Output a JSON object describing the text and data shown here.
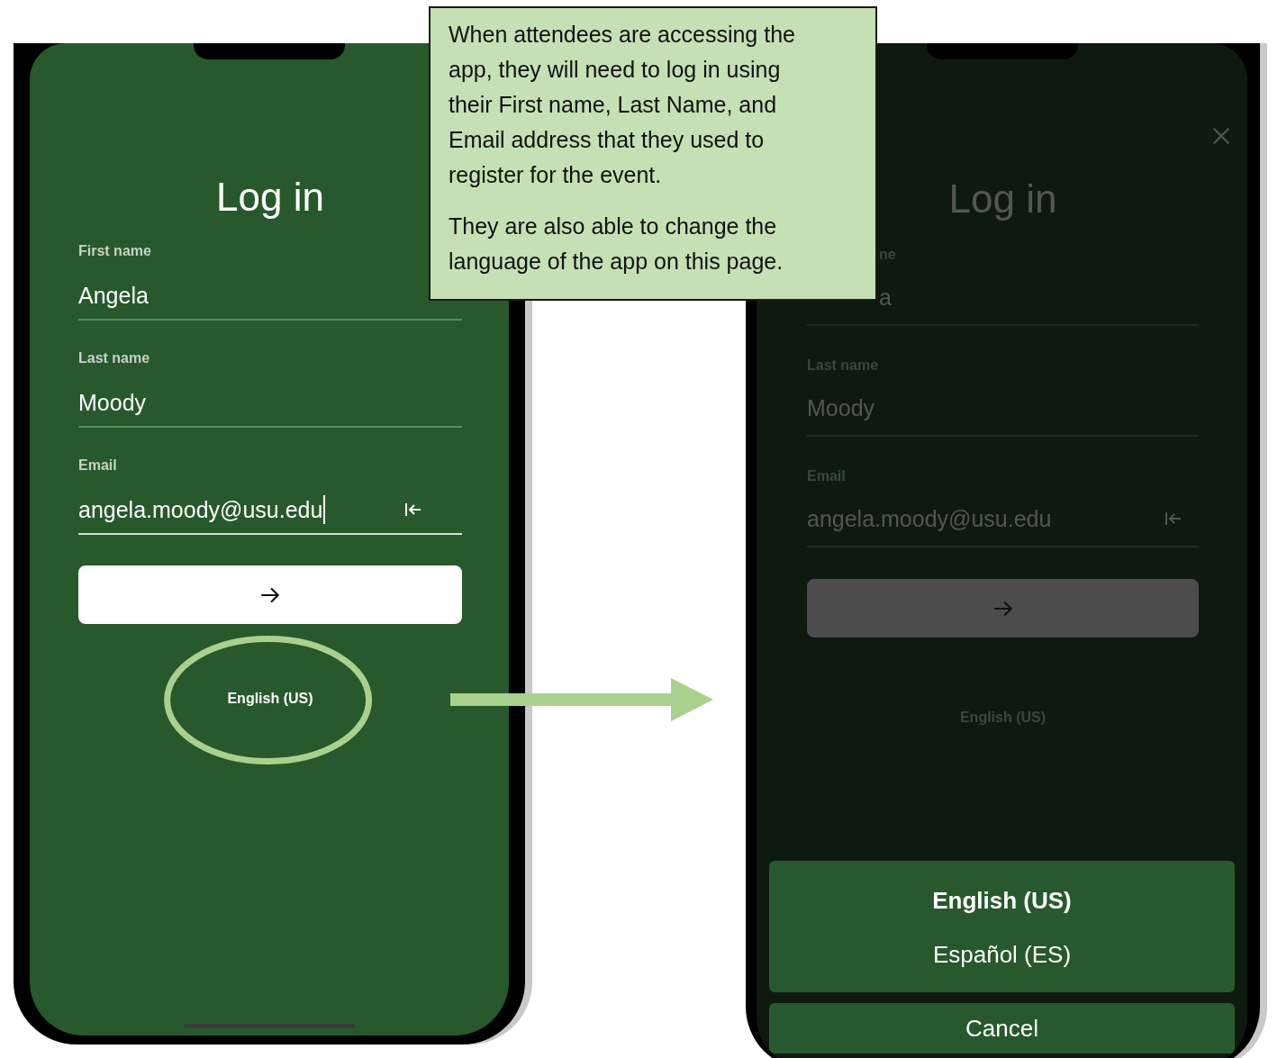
{
  "left_phone": {
    "title": "Log in",
    "fields": [
      {
        "label": "First name",
        "value": "Angela",
        "focused": false,
        "trailing_icon": false
      },
      {
        "label": "Last name",
        "value": "Moody",
        "focused": false,
        "trailing_icon": false
      },
      {
        "label": "Email",
        "value": "angela.moody@usu.edu",
        "focused": true,
        "trailing_icon": true
      }
    ],
    "language_link": "English (US)",
    "language_highlighted": true
  },
  "callout": {
    "paragraphs": [
      "When attendees are accessing the app, they will need to log in using their First name, Last Name, and Email address that they used to register for the event.",
      "They are also able to change the language of the app on this page."
    ]
  },
  "right_phone": {
    "title": "Log in",
    "close_button": true,
    "fields": [
      {
        "label": "ne",
        "value": "a",
        "partly_covered": true,
        "trailing_icon": false
      },
      {
        "label": "Last name",
        "value": "Moody",
        "partly_covered": false,
        "trailing_icon": false
      },
      {
        "label": "Email",
        "value": "angela.moody@usu.edu",
        "partly_covered": false,
        "trailing_icon": true
      }
    ],
    "language_link": "English (US)",
    "action_sheet": {
      "options": [
        {
          "label": "English (US)",
          "selected": true
        },
        {
          "label": "Español (ES)",
          "selected": false
        }
      ],
      "cancel": "Cancel"
    }
  }
}
